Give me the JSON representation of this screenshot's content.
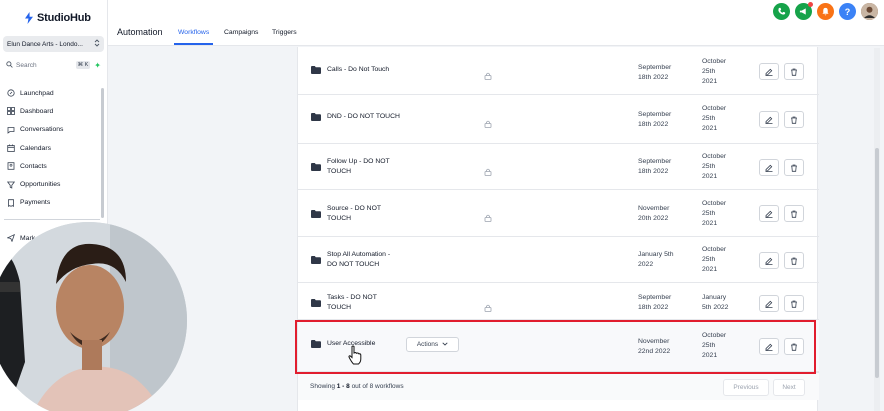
{
  "brand": {
    "name": "StudioHub"
  },
  "account": {
    "name": "Elun Dance Arts - Londo..."
  },
  "search": {
    "placeholder": "Search",
    "shortcut": "⌘ K"
  },
  "nav": {
    "items": [
      {
        "label": "Launchpad",
        "icon": "rocket-icon"
      },
      {
        "label": "Dashboard",
        "icon": "grid-icon"
      },
      {
        "label": "Conversations",
        "icon": "chat-icon"
      },
      {
        "label": "Calendars",
        "icon": "calendar-icon"
      },
      {
        "label": "Contacts",
        "icon": "contacts-icon"
      },
      {
        "label": "Opportunities",
        "icon": "filter-icon"
      },
      {
        "label": "Payments",
        "icon": "receipt-icon"
      }
    ],
    "partial_item": "Mark"
  },
  "header": {
    "section": "Automation",
    "tabs": [
      {
        "label": "Workflows",
        "active": true
      },
      {
        "label": "Campaigns",
        "active": false
      },
      {
        "label": "Triggers",
        "active": false
      }
    ]
  },
  "top_icons": [
    {
      "name": "phone-icon",
      "color": "#16a34a"
    },
    {
      "name": "megaphone-icon",
      "color": "#16a34a"
    },
    {
      "name": "bell-icon",
      "color": "#f97316"
    },
    {
      "name": "help-icon",
      "color": "#3b82f6"
    }
  ],
  "workflows": [
    {
      "name": "Calls - Do Not Touch",
      "locked": true,
      "updated": [
        "September",
        "18th 2022"
      ],
      "created": [
        "October",
        "25th",
        "2021"
      ]
    },
    {
      "name": "DND - DO NOT TOUCH",
      "locked": true,
      "updated": [
        "September",
        "18th 2022"
      ],
      "created": [
        "October",
        "25th",
        "2021"
      ]
    },
    {
      "name": "Follow Up - DO NOT TOUCH",
      "name_lines": [
        "Follow Up - DO NOT",
        "TOUCH"
      ],
      "locked": true,
      "updated": [
        "September",
        "18th 2022"
      ],
      "created": [
        "October",
        "25th",
        "2021"
      ]
    },
    {
      "name": "Source - DO NOT TOUCH",
      "name_lines": [
        "Source - DO NOT",
        "TOUCH"
      ],
      "locked": true,
      "updated": [
        "November",
        "20th 2022"
      ],
      "created": [
        "October",
        "25th",
        "2021"
      ]
    },
    {
      "name": "Stop All Automation - DO NOT TOUCH",
      "name_lines": [
        "Stop All Automation -",
        "DO NOT TOUCH"
      ],
      "locked": false,
      "updated": [
        "January 5th",
        "2022"
      ],
      "created": [
        "October",
        "25th",
        "2021"
      ]
    },
    {
      "name": "Tasks - DO NOT TOUCH",
      "name_lines": [
        "Tasks - DO NOT",
        "TOUCH"
      ],
      "locked": true,
      "updated": [
        "September",
        "18th 2022"
      ],
      "created": [
        "January",
        "5th 2022"
      ]
    },
    {
      "name": "User Accessible",
      "locked": false,
      "actions_label": "Actions",
      "updated": [
        "November",
        "22nd 2022"
      ],
      "created": [
        "October",
        "25th",
        "2021"
      ]
    }
  ],
  "footer": {
    "showing_prefix": "Showing ",
    "range": "1 - 8",
    "showing_suffix": " out of 8 workflows",
    "prev": "Previous",
    "next": "Next"
  }
}
